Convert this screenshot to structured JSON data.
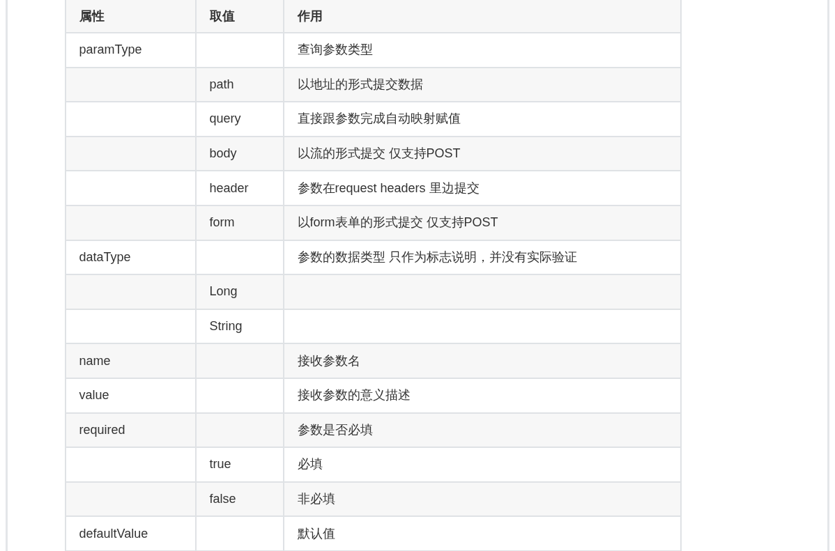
{
  "table": {
    "columns": [
      "属性",
      "取值",
      "作用"
    ],
    "rows": [
      {
        "property": "paramType",
        "description": "查询参数类型"
      },
      {
        "value": "path",
        "description": "以地址的形式提交数据"
      },
      {
        "value": "query",
        "description": "直接跟参数完成自动映射赋值"
      },
      {
        "value": "body",
        "description": "以流的形式提交 仅支持POST"
      },
      {
        "value": "header",
        "description": "参数在request headers 里边提交"
      },
      {
        "value": "form",
        "description": "以form表单的形式提交 仅支持POST"
      },
      {
        "property": "dataType",
        "description": "参数的数据类型 只作为标志说明，并没有实际验证"
      },
      {
        "value": "Long"
      },
      {
        "value": "String"
      },
      {
        "property": "name",
        "description": "接收参数名"
      },
      {
        "property": "value",
        "description": "接收参数的意义描述"
      },
      {
        "property": "required",
        "description": "参数是否必填"
      },
      {
        "value": "true",
        "description": "必填"
      },
      {
        "value": "false",
        "description": "非必填"
      },
      {
        "property": "defaultValue",
        "description": "默认值"
      }
    ]
  }
}
